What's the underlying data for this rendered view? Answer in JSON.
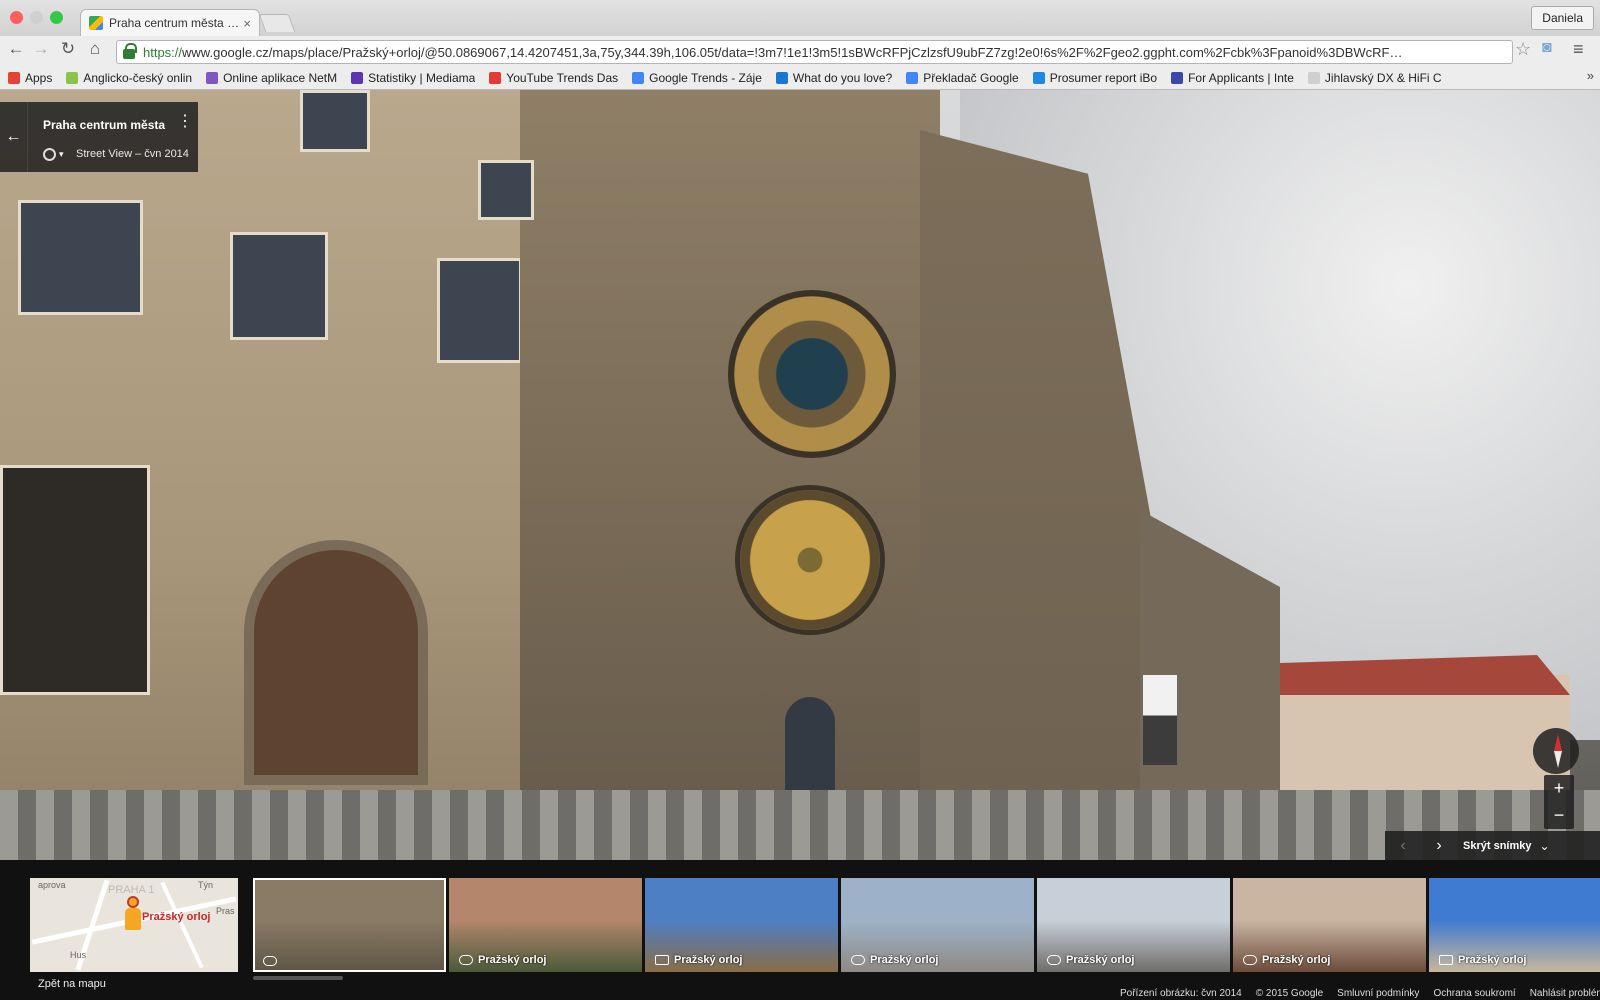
{
  "browser": {
    "tab_title": "Praha centrum města – Ma",
    "tab_close": "×",
    "user_label": "Daniela",
    "url_scheme": "https://",
    "url_rest": "www.google.cz/maps/place/Pražský+orloj/@50.0869067,14.4207451,3a,75y,344.39h,106.05t/data=!3m7!1e1!3m5!1sBWcRFPjCzlzsfU9ubFZ7zg!2e0!6s%2F%2Fgeo2.ggpht.com%2Fcbk%3Fpanoid%3DBWcRF…",
    "bookmarks": [
      {
        "label": "Apps",
        "icon": "apps-grid-icon",
        "color": "#e34234"
      },
      {
        "label": "Anglicko-český onlin",
        "icon": "l-badge-icon",
        "color": "#8bc34a"
      },
      {
        "label": "Online aplikace NetM",
        "icon": "people-icon",
        "color": "#7e57c2"
      },
      {
        "label": "Statistiky | Mediama",
        "icon": "circle-icon",
        "color": "#5e35b1"
      },
      {
        "label": "YouTube Trends Das",
        "icon": "youtube-icon",
        "color": "#e53935"
      },
      {
        "label": "Google Trends - Záje",
        "icon": "google-icon",
        "color": "#4285f4"
      },
      {
        "label": "What do you love?",
        "icon": "heart-icon",
        "color": "#1976d2"
      },
      {
        "label": "Překladač Google",
        "icon": "translate-icon",
        "color": "#4285f4"
      },
      {
        "label": "Prosumer report iBo",
        "icon": "globe-icon",
        "color": "#1e88e5"
      },
      {
        "label": "For Applicants | Inte",
        "icon": "ie-icon",
        "color": "#3949ab"
      },
      {
        "label": "Jihlavský DX & HiFi C",
        "icon": "document-icon",
        "color": "#cfcfcf"
      }
    ],
    "bookmarks_more": "»"
  },
  "infocard": {
    "title": "Praha centrum města",
    "subtitle": "Street View – čvn 2014"
  },
  "controls": {
    "zoom_in": "+",
    "zoom_out": "−",
    "film_prev": "‹",
    "film_next": "›",
    "hide_photos": "Skrýt snímky",
    "hide_chevron": "⌄"
  },
  "minimap": {
    "place_label": "Pražský orloj",
    "labels": [
      "PRAHA 1",
      "Týn",
      "Pras",
      "Hus",
      "aprova"
    ],
    "back_to_map": "Zpět na mapu"
  },
  "thumbnails": [
    {
      "label": "",
      "type": "360",
      "selected": true,
      "colors": [
        "#8a7b64",
        "#5f5546"
      ]
    },
    {
      "label": "Pražský orloj",
      "type": "360",
      "selected": false,
      "colors": [
        "#b4866c",
        "#4a5a3a"
      ]
    },
    {
      "label": "Pražský orloj",
      "type": "photo",
      "selected": false,
      "colors": [
        "#4d7fc4",
        "#8a6d45"
      ]
    },
    {
      "label": "Pražský orloj",
      "type": "360",
      "selected": false,
      "colors": [
        "#9db2c9",
        "#8e8a84"
      ]
    },
    {
      "label": "Pražský orloj",
      "type": "360",
      "selected": false,
      "colors": [
        "#c7cfd8",
        "#6f6d6a"
      ]
    },
    {
      "label": "Pražský orloj",
      "type": "360",
      "selected": false,
      "colors": [
        "#c9b5a2",
        "#6d4b3a"
      ]
    },
    {
      "label": "Pražský orloj",
      "type": "photo",
      "selected": false,
      "colors": [
        "#3f7bd0",
        "#c8b89a"
      ]
    }
  ],
  "footer": {
    "capture_date": "Pořízení obrázku: čvn 2014",
    "copyright": "© 2015 Google",
    "terms": "Smluvní podmínky",
    "privacy": "Ochrana soukromí",
    "report": "Nahlásit problém"
  }
}
